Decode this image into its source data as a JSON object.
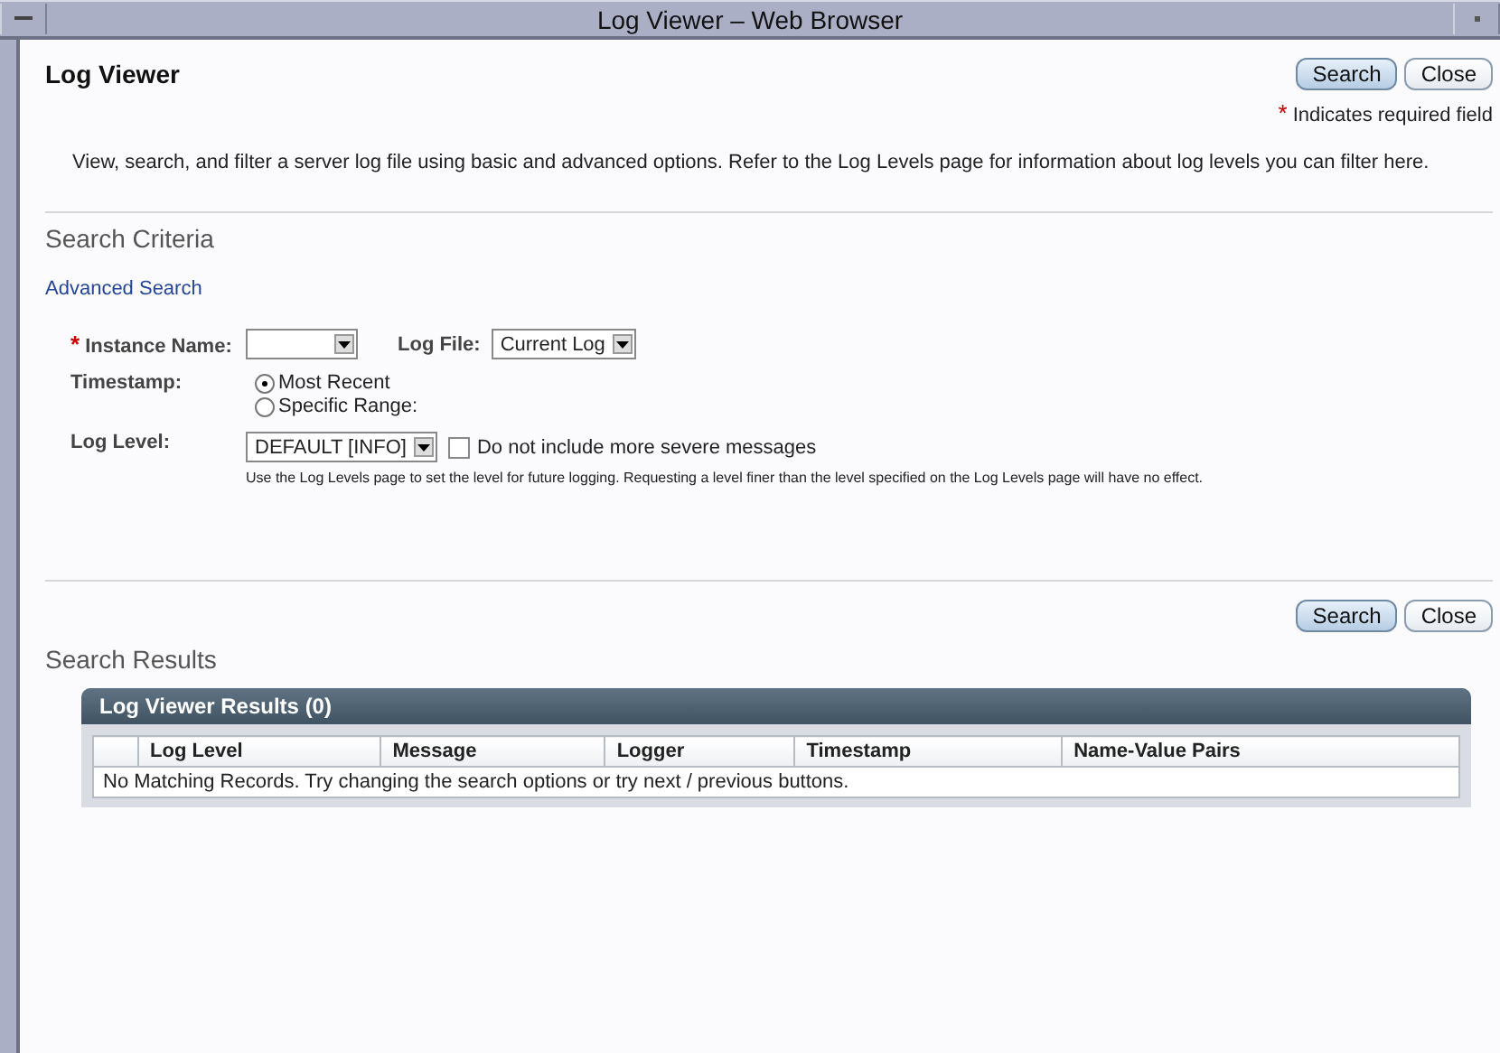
{
  "window": {
    "title": "Log Viewer – Web Browser"
  },
  "page": {
    "title": "Log Viewer",
    "required_note": "Indicates required field",
    "required_mark": "*",
    "description": "View, search, and filter a server log file using basic and advanced options. Refer to the Log Levels page for information about log levels you can filter here."
  },
  "top_buttons": [
    {
      "label": "Search",
      "primary": true
    },
    {
      "label": "Close",
      "primary": false
    }
  ],
  "criteria": {
    "heading": "Search Criteria",
    "advanced_link": "Advanced Search",
    "instance": {
      "label": "Instance Name:",
      "required": true
    },
    "log_file": {
      "label": "Log File:",
      "value": "Current Log"
    },
    "timestamp": {
      "label": "Timestamp:",
      "options": [
        {
          "label": "Most Recent",
          "selected": true
        },
        {
          "label": "Specific Range:",
          "selected": false
        }
      ]
    },
    "log_level": {
      "label": "Log Level:",
      "value": "DEFAULT [INFO]",
      "checkbox": {
        "label": "Do not include more severe messages",
        "checked": false
      },
      "help": "Use the Log Levels page to set the level for future logging. Requesting a level finer than the level specified on the Log Levels page will have no effect."
    }
  },
  "bottom_buttons": [
    {
      "label": "Search",
      "primary": true
    },
    {
      "label": "Close",
      "primary": false
    }
  ],
  "results": {
    "heading": "Search Results",
    "table_title": "Log Viewer Results (0)",
    "columns": [
      "Log Level",
      "Message",
      "Logger",
      "Timestamp",
      "Name-Value Pairs"
    ],
    "empty_message": "No Matching Records. Try changing the search options or try next / previous buttons."
  }
}
